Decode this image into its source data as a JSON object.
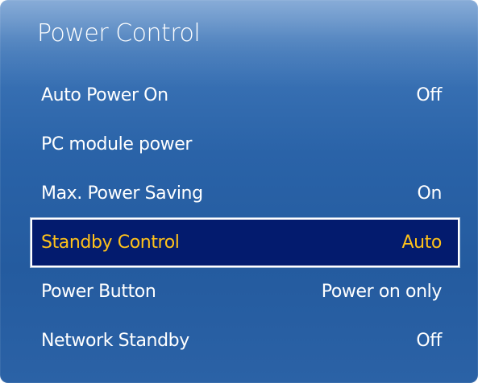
{
  "title": "Power Control",
  "items": [
    {
      "label": "Auto Power On",
      "value": "Off"
    },
    {
      "label": "PC module power",
      "value": ""
    },
    {
      "label": "Max. Power Saving",
      "value": "On"
    },
    {
      "label": "Standby Control",
      "value": "Auto"
    },
    {
      "label": "Power Button",
      "value": "Power on only"
    },
    {
      "label": "Network Standby",
      "value": "Off"
    }
  ],
  "selected_index": 3,
  "colors": {
    "panel": "#2a63a8",
    "selected_background": "#031b6e",
    "selected_text": "#ffc21a",
    "text": "#ffffff"
  }
}
